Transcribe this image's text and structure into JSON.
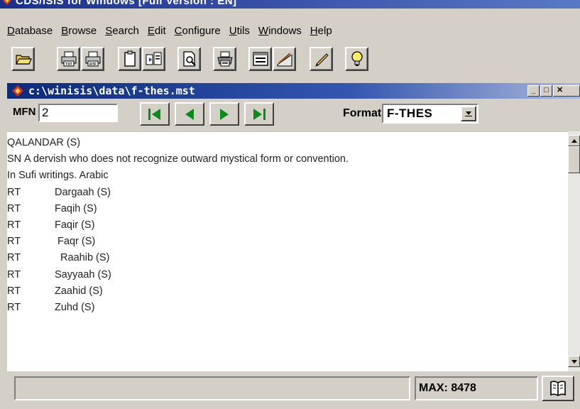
{
  "app": {
    "title": "CDS/ISIS for Windows [Full Version : EN]"
  },
  "menu": [
    {
      "mnemonic": "D",
      "rest": "atabase"
    },
    {
      "mnemonic": "B",
      "rest": "rowse"
    },
    {
      "mnemonic": "S",
      "rest": "earch"
    },
    {
      "mnemonic": "E",
      "rest": "dit"
    },
    {
      "mnemonic": "C",
      "rest": "onfigure"
    },
    {
      "mnemonic": "U",
      "rest": "tils"
    },
    {
      "mnemonic": "W",
      "rest": "indows"
    },
    {
      "mnemonic": "H",
      "rest": "elp"
    }
  ],
  "toolbar": {
    "buttons": [
      {
        "icon": "open-folder-icon"
      },
      {
        "icon": "print-txt-icon",
        "label": "TXT"
      },
      {
        "icon": "print-rtf-icon",
        "label": "RTF"
      },
      {
        "icon": "clipboard-icon"
      },
      {
        "icon": "copy-record-icon"
      },
      {
        "icon": "preview-icon"
      },
      {
        "icon": "printer-icon"
      },
      {
        "icon": "form-icon"
      },
      {
        "icon": "edit-hand-icon"
      },
      {
        "icon": "pencil-icon"
      },
      {
        "icon": "lightbulb-icon"
      }
    ]
  },
  "document": {
    "title": "c:\\winisis\\data\\f-thes.mst"
  },
  "nav": {
    "mfn_label": "MFN",
    "mfn_value": "2",
    "format_label": "Format:",
    "format_value": "F-THES"
  },
  "record": {
    "heading": "QALANDAR (S)",
    "scope_tag": "SN",
    "scope_note": "A dervish who does not recognize outward mystical form or convention.",
    "scope_note_cont": "In Sufi writings. Arabic",
    "related": [
      {
        "tag": "RT",
        "term": "Dargaah (S)"
      },
      {
        "tag": "RT",
        "term": "Faqih (S)"
      },
      {
        "tag": "RT",
        "term": "Faqir (S)"
      },
      {
        "tag": "RT",
        "term": " Faqr (S)"
      },
      {
        "tag": "RT",
        "term": "  Raahib (S)"
      },
      {
        "tag": "RT",
        "term": "Sayyaah (S)"
      },
      {
        "tag": "RT",
        "term": "Zaahid (S)"
      },
      {
        "tag": "RT",
        "term": "Zuhd (S)"
      }
    ]
  },
  "status": {
    "message": "",
    "max": "MAX: 8478"
  },
  "colors": {
    "doc_title_gradient_start": "#0b2a7c",
    "doc_title_gradient_end": "#a9b8dc",
    "nav_arrow": "#0b8a1e",
    "chrome": "#d4d0c8"
  }
}
